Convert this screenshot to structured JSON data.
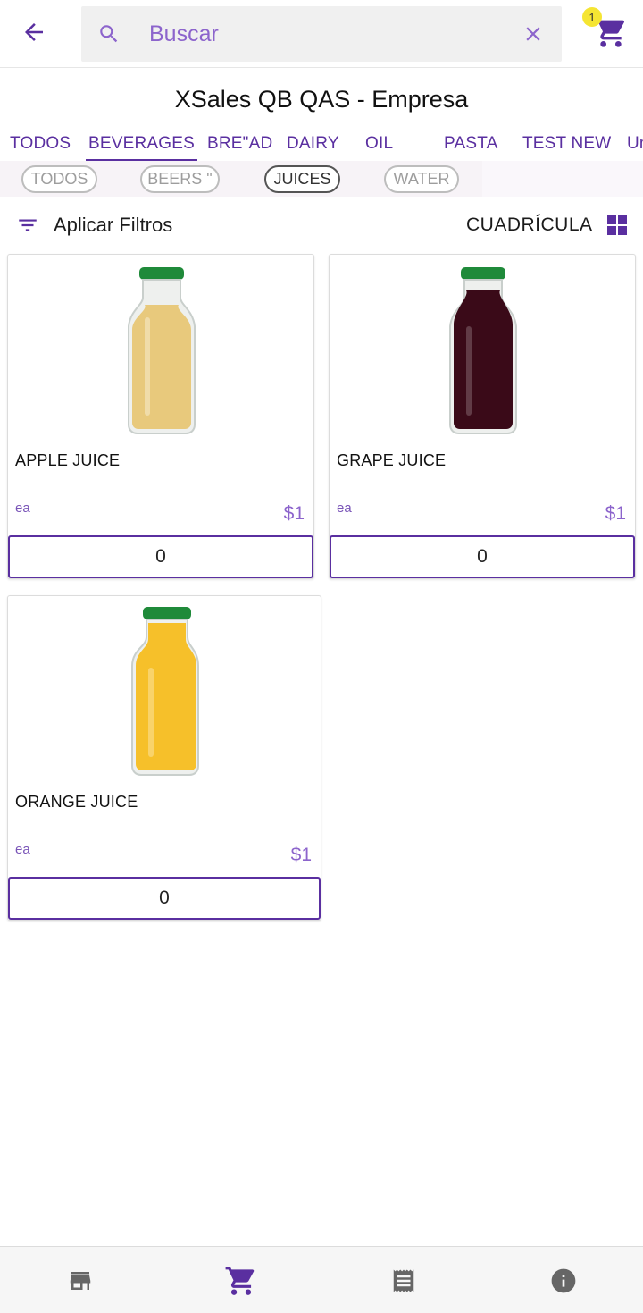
{
  "search": {
    "placeholder": "Buscar"
  },
  "cart": {
    "badge_count": "1"
  },
  "company_title": "XSales QB QAS - Empresa",
  "categories": [
    "TODOS",
    "BEVERAGES",
    "BRE\"AD",
    "DAIRY",
    "OIL",
    "PASTA",
    "TEST NEW",
    "Un"
  ],
  "active_category": "BEVERAGES",
  "subcategories": [
    "TODOS",
    "BEERS \"",
    "JUICES",
    "WATER"
  ],
  "active_subcategory": "JUICES",
  "filters": {
    "label": "Aplicar Filtros"
  },
  "view_mode": {
    "label": "CUADRÍCULA"
  },
  "products": [
    {
      "name": "APPLE JUICE",
      "unit": "ea",
      "price": "$1",
      "qty": "0",
      "juice_color": "#e8c97c"
    },
    {
      "name": "GRAPE JUICE",
      "unit": "ea",
      "price": "$1",
      "qty": "0",
      "juice_color": "#3a0a18"
    },
    {
      "name": "ORANGE JUICE",
      "unit": "ea",
      "price": "$1",
      "qty": "0",
      "juice_color": "#f6c02a"
    }
  ],
  "colors": {
    "accent": "#5a2fa0",
    "price": "#8c64cc",
    "badge": "#f5e533"
  },
  "bottom_nav": [
    "store-icon",
    "cart-icon",
    "receipt-icon",
    "info-icon"
  ]
}
